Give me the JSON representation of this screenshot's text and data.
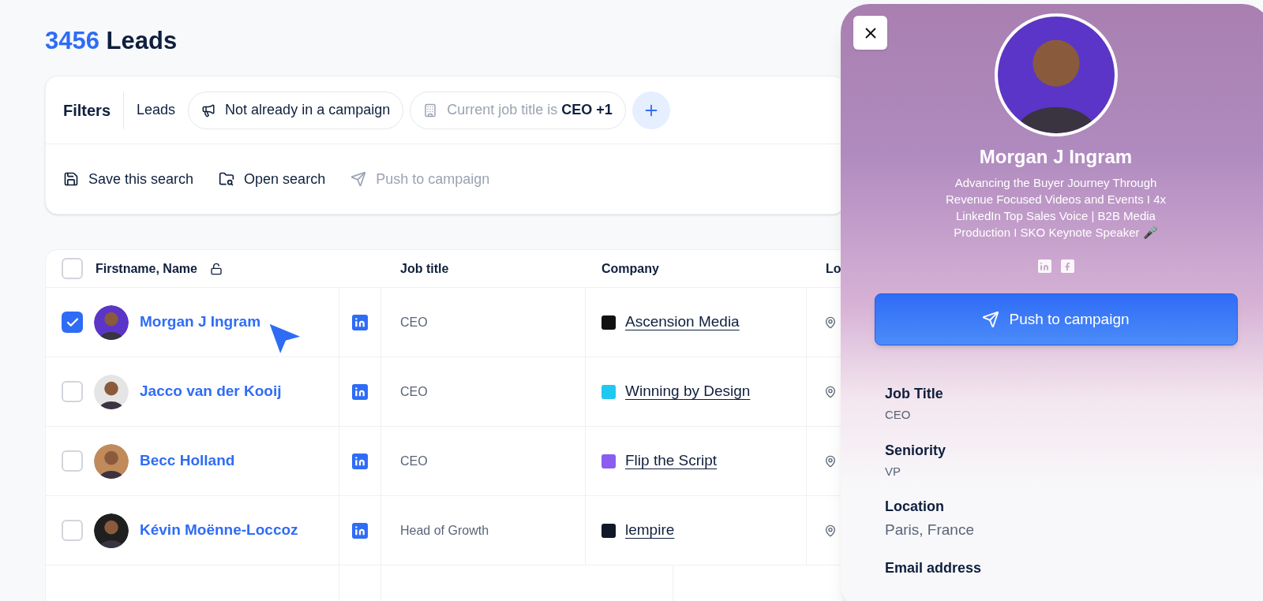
{
  "header": {
    "count": "3456",
    "title": "Leads"
  },
  "filters": {
    "label": "Filters",
    "scope": "Leads",
    "chips": [
      {
        "kind": "campaign",
        "text": "Not already in a campaign"
      },
      {
        "kind": "job",
        "text": "Current job title is",
        "bold": "CEO +1"
      }
    ]
  },
  "actions": [
    {
      "kind": "save",
      "label": "Save this search",
      "disabled": false
    },
    {
      "kind": "open",
      "label": "Open search",
      "disabled": false
    },
    {
      "kind": "push",
      "label": "Push to campaign",
      "disabled": true
    }
  ],
  "table": {
    "select_all_checked": false,
    "columns": [
      "Firstname, Name",
      "Job title",
      "Company",
      "Lo"
    ],
    "rows": [
      {
        "name": "Morgan J Ingram",
        "selected": true,
        "job": "CEO",
        "company": "Ascension Media",
        "color": "#111111"
      },
      {
        "name": "Jacco van der Kooij",
        "selected": false,
        "job": "CEO",
        "company": "Winning by Design",
        "color": "#1fc8f0"
      },
      {
        "name": "Becc Holland",
        "selected": false,
        "job": "CEO",
        "company": "Flip the Script",
        "color": "#8a5cf0"
      },
      {
        "name": "Kévin Moënne-Loccoz",
        "selected": false,
        "job": "Head of Growth",
        "company": "lempire",
        "color": "#111827"
      }
    ]
  },
  "panel": {
    "name": "Morgan J Ingram",
    "bio": "Advancing the Buyer Journey Through Revenue Focused Videos and Events I 4x LinkedIn Top Sales Voice | B2B Media Production I SKO Keynote Speaker 🎤",
    "button": "Push to campaign",
    "details": [
      {
        "label": "Job Title",
        "value": "CEO"
      },
      {
        "label": "Seniority",
        "value": "VP"
      },
      {
        "label": "Location",
        "value": "Paris, France"
      },
      {
        "label": "Email address"
      }
    ]
  }
}
